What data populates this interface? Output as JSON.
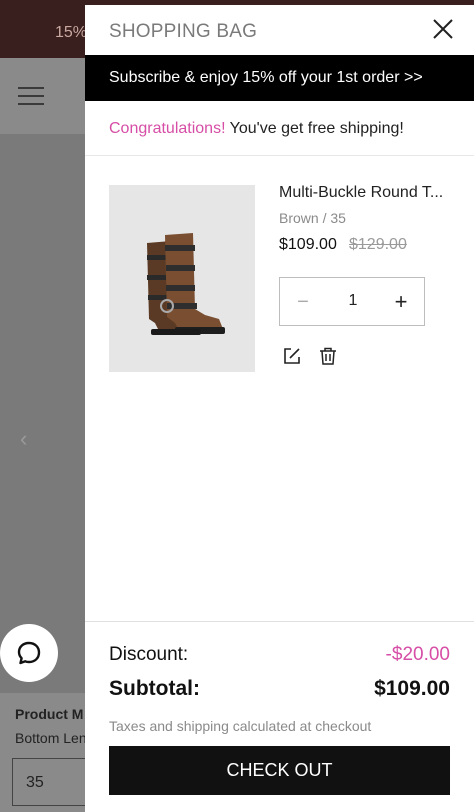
{
  "background": {
    "banner_text": "15%",
    "product_title": "Product M",
    "product_subtitle": "Bottom Len",
    "size_value": "35"
  },
  "drawer": {
    "title": "SHOPPING BAG",
    "subscribe_text": "Subscribe & enjoy 15% off your 1st order >>",
    "shipping": {
      "congrats": "Congratulations!",
      "message": " You've get free shipping!"
    },
    "item": {
      "name": "Multi-Buckle Round T...",
      "variant": "Brown / 35",
      "price": "$109.00",
      "original_price": "$129.00",
      "quantity": "1"
    },
    "summary": {
      "discount_label": "Discount:",
      "discount_value": "-$20.00",
      "subtotal_label": "Subtotal:",
      "subtotal_value": "$109.00",
      "tax_note": "Taxes and shipping calculated at checkout",
      "checkout_label": "CHECK OUT"
    }
  },
  "icons": [
    "menu-icon",
    "chevron-left-icon",
    "chat-icon",
    "close-icon",
    "minus-icon",
    "plus-icon",
    "edit-icon",
    "trash-icon"
  ],
  "colors": {
    "accent_pink": "#d64ea6",
    "dark": "#111111"
  }
}
